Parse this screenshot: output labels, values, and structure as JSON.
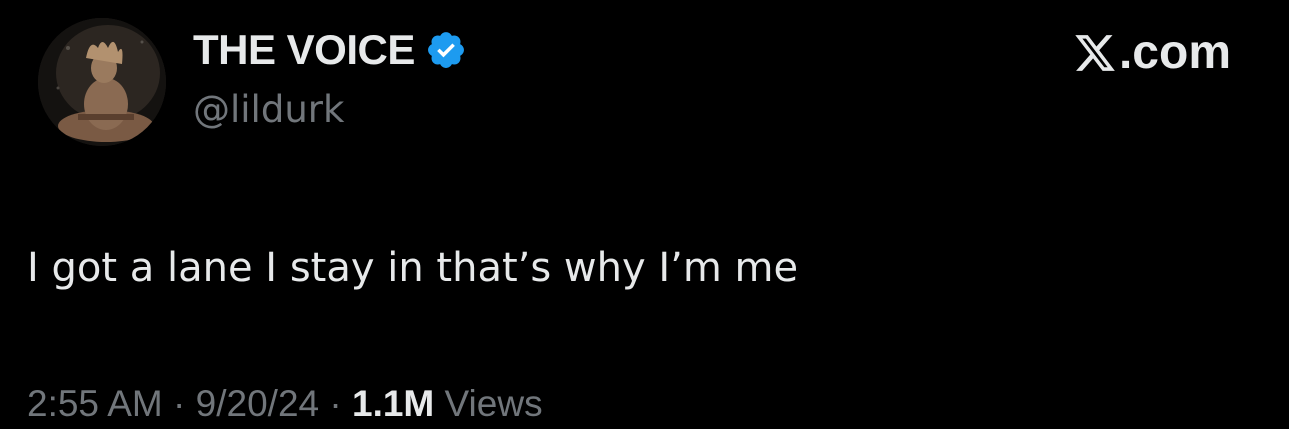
{
  "author": {
    "display_name": "THE VOICE",
    "handle": "@lildurk",
    "verified": true,
    "verified_icon": "verified-badge-icon",
    "verified_color": "#1d9bf0"
  },
  "brand": {
    "label": ".com",
    "icon": "x-logo-icon"
  },
  "tweet": {
    "text": "I got a lane I stay in that’s why I’m me"
  },
  "meta": {
    "time": "2:55 AM",
    "separator": "·",
    "date": "9/20/24",
    "views_count": "1.1M",
    "views_label": "Views"
  },
  "colors": {
    "background": "#000000",
    "primary_text": "#e7e9ea",
    "secondary_text": "#71767b"
  }
}
